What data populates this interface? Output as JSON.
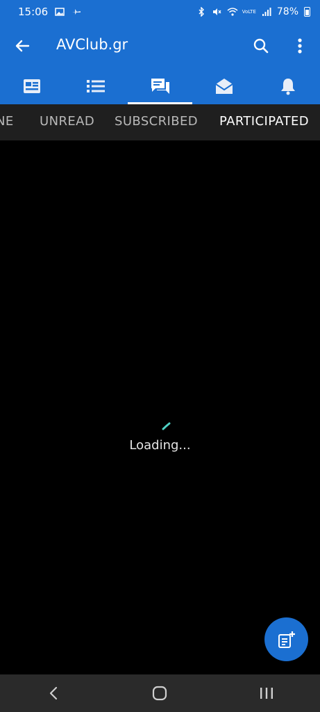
{
  "status_bar": {
    "time": "15:06",
    "battery": "78%",
    "icons": [
      "gallery-icon",
      "plane-icon",
      "bluetooth-icon",
      "mute-icon",
      "wifi-icon",
      "volte-lte-icon",
      "signal-icon",
      "battery-icon"
    ],
    "volte_label": "VoLTE"
  },
  "app_bar": {
    "title": "AVClub.gr"
  },
  "icon_tabs": [
    {
      "name": "news-icon",
      "active": false
    },
    {
      "name": "list-icon",
      "active": false
    },
    {
      "name": "forum-icon",
      "active": true
    },
    {
      "name": "inbox-icon",
      "active": false
    },
    {
      "name": "bell-icon",
      "active": false
    }
  ],
  "text_tabs": [
    {
      "label": "NE"
    },
    {
      "label": "UNREAD"
    },
    {
      "label": "SUBSCRIBED"
    },
    {
      "label": "PARTICIPATED",
      "active": true
    }
  ],
  "content": {
    "loading_text": "Loading..."
  },
  "colors": {
    "primary": "#1b6fd1",
    "tab_bar": "#1f1f1f",
    "background": "#000000",
    "spinner": "#4fd1c5"
  }
}
